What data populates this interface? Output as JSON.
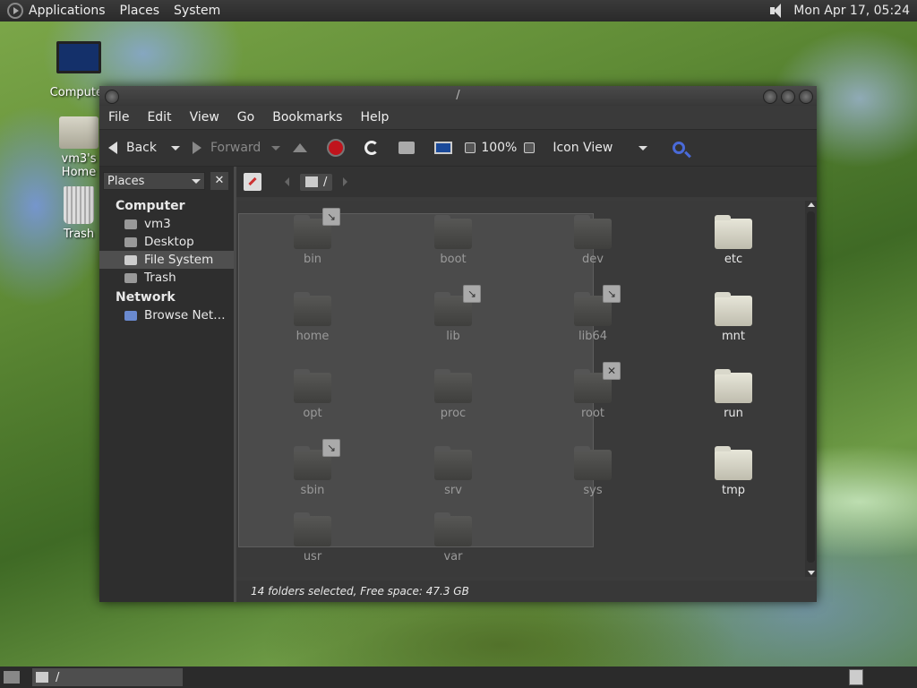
{
  "topbar": {
    "menus": [
      "Applications",
      "Places",
      "System"
    ],
    "clock": "Mon Apr 17, 05:24"
  },
  "desktop": {
    "icons": [
      {
        "label": "Computer"
      },
      {
        "label": "vm3's Home"
      },
      {
        "label": "Trash"
      }
    ]
  },
  "window": {
    "title": "/",
    "menubar": [
      "File",
      "Edit",
      "View",
      "Go",
      "Bookmarks",
      "Help"
    ],
    "toolbar": {
      "back": "Back",
      "forward": "Forward",
      "zoom": "100%",
      "view_mode": "Icon View"
    },
    "sidebar": {
      "selector": "Places",
      "close": "✕",
      "sections": [
        {
          "title": "Computer",
          "items": [
            "vm3",
            "Desktop",
            "File System",
            "Trash"
          ]
        },
        {
          "title": "Network",
          "items": [
            "Browse Net…"
          ]
        }
      ],
      "selected": "File System"
    },
    "location": {
      "crumb": "/"
    },
    "files": [
      {
        "name": "bin",
        "selected": true,
        "emblem": "link"
      },
      {
        "name": "boot",
        "selected": true
      },
      {
        "name": "dev",
        "selected": true
      },
      {
        "name": "etc",
        "selected": false
      },
      {
        "name": "home",
        "selected": true
      },
      {
        "name": "lib",
        "selected": true,
        "emblem": "link"
      },
      {
        "name": "lib64",
        "selected": true,
        "emblem": "link"
      },
      {
        "name": "mnt",
        "selected": false
      },
      {
        "name": "opt",
        "selected": true
      },
      {
        "name": "proc",
        "selected": true
      },
      {
        "name": "root",
        "selected": true,
        "emblem": "unreadable"
      },
      {
        "name": "run",
        "selected": false
      },
      {
        "name": "sbin",
        "selected": true,
        "emblem": "link"
      },
      {
        "name": "srv",
        "selected": true
      },
      {
        "name": "sys",
        "selected": true
      },
      {
        "name": "tmp",
        "selected": false
      },
      {
        "name": "usr",
        "selected": true
      },
      {
        "name": "var",
        "selected": true
      }
    ],
    "status": "14 folders selected, Free space: 47.3 GB"
  },
  "taskbar": {
    "task_label": "/"
  },
  "colors": {
    "panel": "#2a2a2a",
    "window_bg": "#3b3b3b",
    "stop": "#c0141c",
    "search": "#4a6ad8"
  }
}
